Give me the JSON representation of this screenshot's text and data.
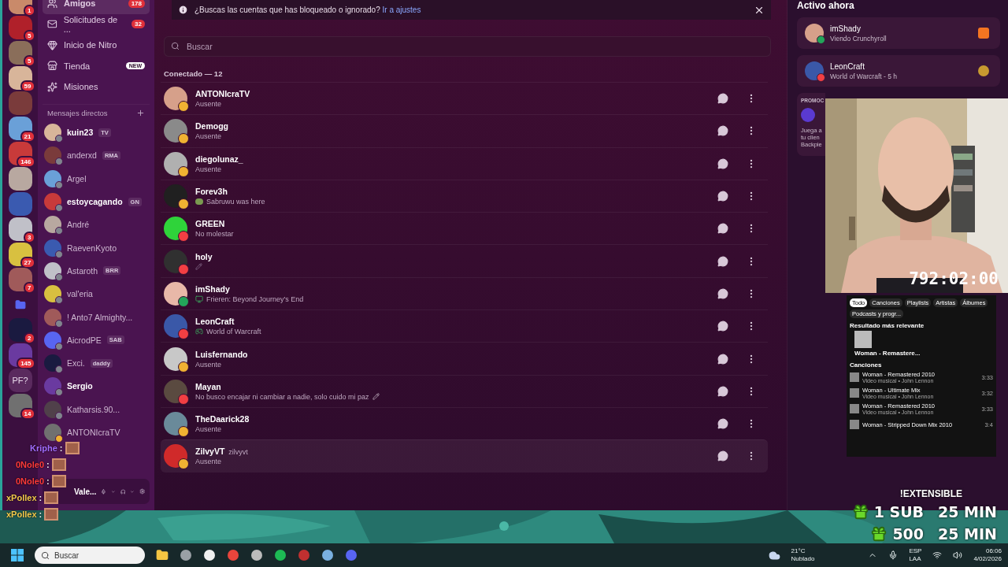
{
  "server_rail": {
    "items": [
      {
        "kind": "avatar",
        "badge": "1"
      },
      {
        "kind": "avatar",
        "badge": "5"
      },
      {
        "kind": "avatar",
        "badge": "5"
      },
      {
        "kind": "avatar",
        "badge": "59"
      },
      {
        "kind": "avatar"
      },
      {
        "kind": "avatar",
        "badge": "21"
      },
      {
        "kind": "avatar",
        "badge": "146"
      },
      {
        "kind": "avatar"
      },
      {
        "kind": "avatar"
      },
      {
        "kind": "avatar",
        "badge": "3"
      },
      {
        "kind": "avatar",
        "badge": "27"
      },
      {
        "kind": "avatar",
        "badge": "7"
      },
      {
        "kind": "folder"
      },
      {
        "kind": "avatar",
        "badge": "2"
      },
      {
        "kind": "avatar",
        "badge": "145"
      },
      {
        "kind": "text",
        "label": "PF?"
      },
      {
        "kind": "avatar",
        "badge": "14"
      }
    ]
  },
  "sidebar": {
    "nav": [
      {
        "label": "Amigos",
        "badge": "178",
        "selected": true
      },
      {
        "label": "Solicitudes de ...",
        "badge": "32",
        "selected": false
      },
      {
        "label": "Inicio de Nitro",
        "selected": false
      },
      {
        "label": "Tienda",
        "tag": "NEW",
        "selected": false
      },
      {
        "label": "Misiones",
        "selected": false
      }
    ],
    "dm_title": "Mensajes directos",
    "dms": [
      {
        "name": "kuin23",
        "tag": "TV",
        "unread": true,
        "color": "#80848e"
      },
      {
        "name": "anderxd",
        "tag": "RMA",
        "unread": false,
        "color": "#80848e"
      },
      {
        "name": "Argel",
        "unread": false,
        "color": "#80848e"
      },
      {
        "name": "estoycagando",
        "tag": "GN",
        "unread": true,
        "color": "#80848e"
      },
      {
        "name": "André",
        "unread": false,
        "color": "#80848e"
      },
      {
        "name": "RaevenKyoto",
        "unread": false,
        "color": "#80848e"
      },
      {
        "name": "Astaroth",
        "tag": "BRR",
        "unread": false,
        "color": "#80848e"
      },
      {
        "name": "val'eria",
        "unread": false,
        "color": "#80848e"
      },
      {
        "name": "! Anto7 Almighty...",
        "unread": false,
        "color": "#80848e"
      },
      {
        "name": "AicrodPE",
        "tag": "SAB",
        "unread": false,
        "color": "#80848e"
      },
      {
        "name": "Exci.",
        "tag": "daddy",
        "unread": false,
        "color": "#80848e"
      },
      {
        "name": "Sergio",
        "unread": true,
        "color": "#80848e"
      },
      {
        "name": "Katharsis.90...",
        "unread": false,
        "color": "#80848e"
      },
      {
        "name": "ANTONIcraTV",
        "unread": false,
        "color": "#f0b232"
      }
    ],
    "user_panel": {
      "name": "Vale..."
    }
  },
  "main": {
    "notice": {
      "text": "¿Buscas las cuentas que has bloqueado o ignorado?",
      "link": "Ir a ajustes"
    },
    "search": {
      "placeholder": "Buscar"
    },
    "section": "Conectado — 12",
    "friends": [
      {
        "name": "ANTONIcraTV",
        "color": "#f0b232",
        "kind": "plain",
        "text": "Ausente",
        "highlighted": false
      },
      {
        "name": "Demogg",
        "color": "#f0b232",
        "kind": "plain",
        "text": "Ausente",
        "highlighted": false
      },
      {
        "name": "diegolunaz_",
        "color": "#f0b232",
        "kind": "plain",
        "text": "Ausente",
        "highlighted": false
      },
      {
        "name": "Forev3h",
        "color": "#f0b232",
        "kind": "custom",
        "text": "Sabruwu was here",
        "highlighted": false
      },
      {
        "name": "GREEN",
        "color": "#f23f43",
        "kind": "plain",
        "text": "No molestar",
        "highlighted": false
      },
      {
        "name": "holy",
        "color": "#f23f43",
        "kind": "emoji",
        "highlighted": false
      },
      {
        "name": "imShady",
        "color": "#23a55a",
        "kind": "watching",
        "text": "Frieren: Beyond Journey's End",
        "highlighted": false
      },
      {
        "name": "LeonCraft",
        "color": "#f23f43",
        "kind": "playing",
        "text": "World of Warcraft",
        "highlighted": false
      },
      {
        "name": "Luisfernando",
        "color": "#f0b232",
        "kind": "plain",
        "text": "Ausente",
        "highlighted": false
      },
      {
        "name": "Mayan",
        "color": "#f23f43",
        "kind": "note",
        "text": "No busco encajar ni cambiar a nadie, solo cuido mi paz",
        "highlighted": false
      },
      {
        "name": "TheDaarick28",
        "color": "#f0b232",
        "kind": "plain",
        "text": "Ausente",
        "highlighted": false
      },
      {
        "name": "ZilvyVT",
        "username": "zilvyvt",
        "color": "#f0b232",
        "kind": "plain",
        "text": "Ausente",
        "highlighted": true
      }
    ]
  },
  "active_now": {
    "title": "Activo ahora",
    "cards": [
      {
        "name": "imShady",
        "detail": "Viendo Crunchyroll",
        "color": "#23a55a"
      },
      {
        "name": "LeonCraft",
        "detail": "World of Warcraft - 5 h",
        "color": "#f23f43"
      }
    ],
    "promo": {
      "label": "PROMOC",
      "lines": [
        "Juega a",
        "tu clien",
        "Backpie"
      ]
    }
  },
  "webcam": {
    "kind": "picture",
    "timer": "792:02:00"
  },
  "spotify": {
    "tabs": [
      {
        "label": "Todo",
        "selected": true
      },
      {
        "label": "Canciones",
        "selected": false
      },
      {
        "label": "Playlists",
        "selected": false
      },
      {
        "label": "Artistas",
        "selected": false
      },
      {
        "label": "Álbumes",
        "selected": false
      },
      {
        "label": "Podcasts y progr...",
        "selected": false
      }
    ],
    "top_title": "Resultado más relevante",
    "top_name": "Woman - Remastere...",
    "songs_title": "Canciones",
    "songs": [
      {
        "title": "Woman - Remastered 2010",
        "sub": "Video musical • John Lennon",
        "time": "3:33"
      },
      {
        "title": "Woman - Ultimate Mix",
        "sub": "Video musical • John Lennon",
        "time": "3:32"
      },
      {
        "title": "Woman - Remastered 2010",
        "sub": "Video musical • John Lennon",
        "time": "3:33"
      },
      {
        "title": "Woman - Stripped Down Mix 2010",
        "time": "3:4"
      }
    ]
  },
  "chat_overlay": [
    {
      "user": "Kriphe",
      "color": "#a26cff"
    },
    {
      "user": "0Nole0",
      "color": "#ff3a3a"
    },
    {
      "user": "0Nole0",
      "color": "#ff3a3a"
    },
    {
      "user": "xPollex",
      "color": "#f2c94c"
    },
    {
      "user": "xPollex",
      "color": "#f2c94c"
    }
  ],
  "chat_separator": ":",
  "goals": {
    "title": "!EXTENSIBLE",
    "rows": [
      {
        "amount": "1 SUB",
        "time": "25 MIN"
      },
      {
        "amount": "500",
        "time": "25 MIN"
      }
    ]
  },
  "taskbar": {
    "search": "Buscar",
    "temp": "21°C",
    "weather": "Nublado",
    "lang": [
      "ESP",
      "LAA"
    ],
    "time": "06:06",
    "date": "4/02/2026"
  }
}
